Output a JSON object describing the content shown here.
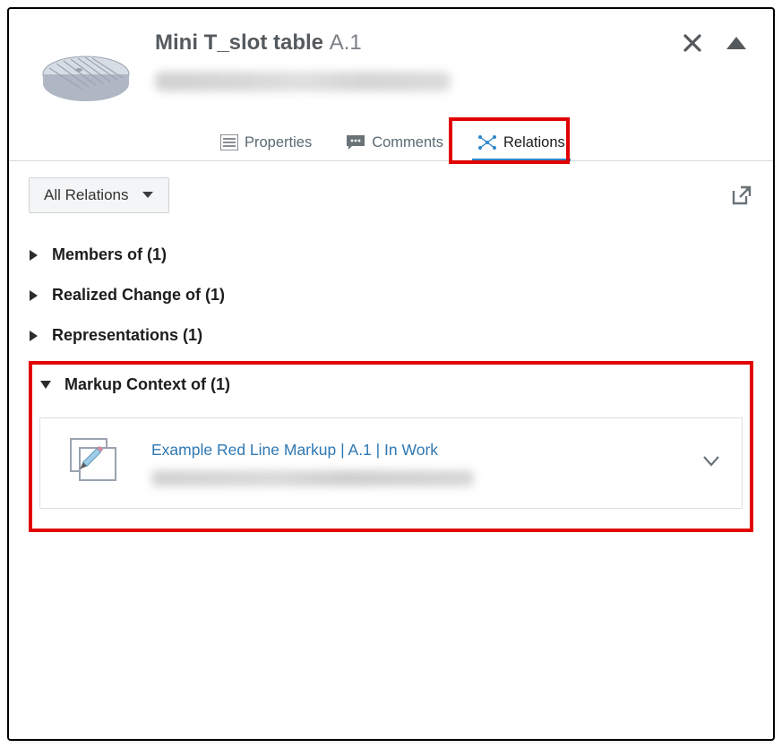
{
  "header": {
    "title": "Mini T_slot table",
    "revision": "A.1"
  },
  "tabs": {
    "properties": "Properties",
    "comments": "Comments",
    "relations": "Relations",
    "active": "relations"
  },
  "filter": {
    "label": "All Relations"
  },
  "sections": {
    "members": {
      "label": "Members of",
      "count": 1,
      "expanded": false
    },
    "realized": {
      "label": "Realized Change of",
      "count": 1,
      "expanded": false
    },
    "representations": {
      "label": "Representations",
      "count": 1,
      "expanded": false
    },
    "markup": {
      "label": "Markup Context of",
      "count": 1,
      "expanded": true
    }
  },
  "markup_item": {
    "title": "Example Red Line Markup | A.1 | In Work"
  },
  "colors": {
    "highlight": "#e10000",
    "link": "#2e78b3",
    "tab_active": "#2f86c9"
  }
}
